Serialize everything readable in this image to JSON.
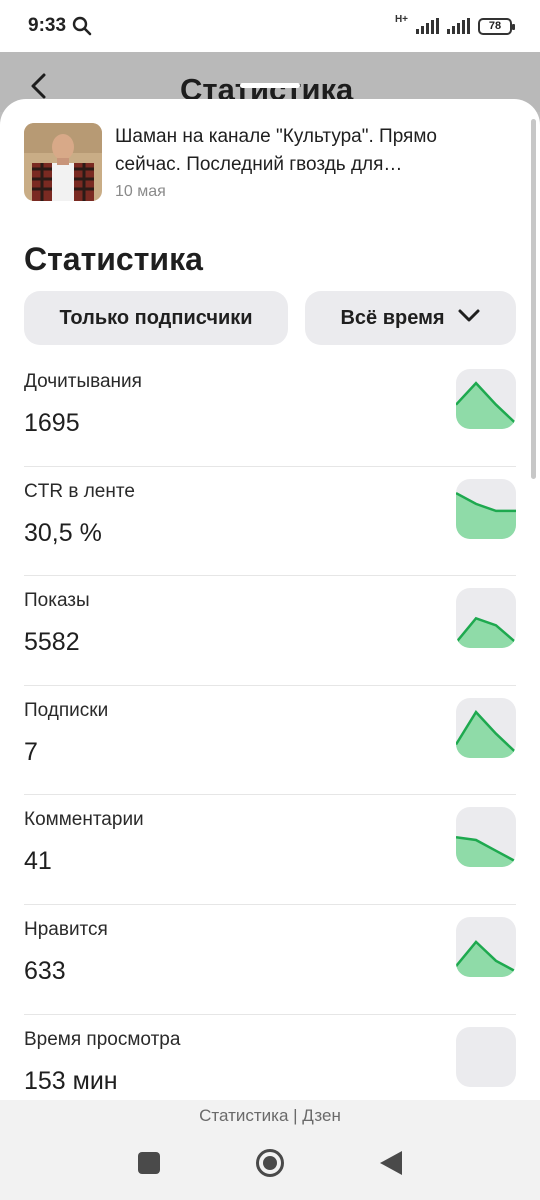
{
  "status_bar": {
    "time": "9:33",
    "network": "H+",
    "battery": "78"
  },
  "background_header": {
    "title": "Статистика"
  },
  "article": {
    "title": "Шаман на канале \"Культура\". Прямо сейчас. Последний гвоздь для…",
    "date": "10 мая"
  },
  "section_title": "Статистика",
  "filters": {
    "audience": "Только подписчики",
    "period": "Всё время"
  },
  "metrics": [
    {
      "label": "Дочитывания",
      "value": "1695",
      "trend": [
        0.45,
        0.85,
        0.45,
        0.1
      ]
    },
    {
      "label": "CTR в ленте",
      "value": "30,5 %",
      "trend": [
        0.85,
        0.65,
        0.52,
        0.52
      ]
    },
    {
      "label": "Показы",
      "value": "5582",
      "trend": [
        0.1,
        0.55,
        0.42,
        0.1
      ]
    },
    {
      "label": "Подписки",
      "value": "7",
      "trend": [
        0.25,
        0.85,
        0.45,
        0.1
      ]
    },
    {
      "label": "Комментарии",
      "value": "41",
      "trend": [
        0.55,
        0.5,
        0.3,
        0.1
      ]
    },
    {
      "label": "Нравится",
      "value": "633",
      "trend": [
        0.2,
        0.65,
        0.3,
        0.1
      ]
    },
    {
      "label": "Время просмотра",
      "value": "153 мин",
      "trend": []
    }
  ],
  "colors": {
    "spark_line": "#1ea94f",
    "spark_fill": "#8fdba8"
  },
  "footer": {
    "caption": "Статистика | Дзен"
  }
}
